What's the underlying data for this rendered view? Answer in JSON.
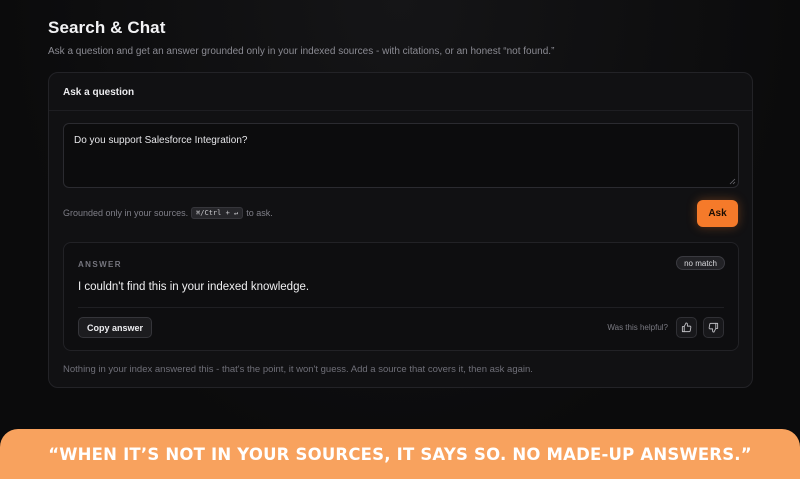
{
  "header": {
    "title": "Search & Chat",
    "subtitle": "Ask a question and get an answer grounded only in your indexed sources - with citations, or an honest “not found.”"
  },
  "ask_card": {
    "heading": "Ask a question",
    "question_value": "Do you support Salesforce Integration?",
    "hint_prefix": "Grounded only in your sources.",
    "shortcut": "⌘/Ctrl + ↵",
    "hint_suffix": "to ask.",
    "ask_label": "Ask"
  },
  "answer": {
    "label": "ANSWER",
    "badge": "no match",
    "text": "I couldn't find this in your indexed knowledge.",
    "copy_label": "Copy answer",
    "helpful_label": "Was this helpful?",
    "icons": {
      "up": "thumbs-up-icon",
      "down": "thumbs-down-icon"
    }
  },
  "footer_note": "Nothing in your index answered this - that's the point, it won't guess. Add a source that covers it, then ask again.",
  "banner": {
    "text": "“WHEN IT’S NOT IN YOUR SOURCES, IT SAYS SO. NO MADE-UP ANSWERS.”"
  },
  "colors": {
    "accent": "#f57a2a",
    "banner": "#f8a25e",
    "background": "#0b0b0c",
    "card": "#111113"
  }
}
